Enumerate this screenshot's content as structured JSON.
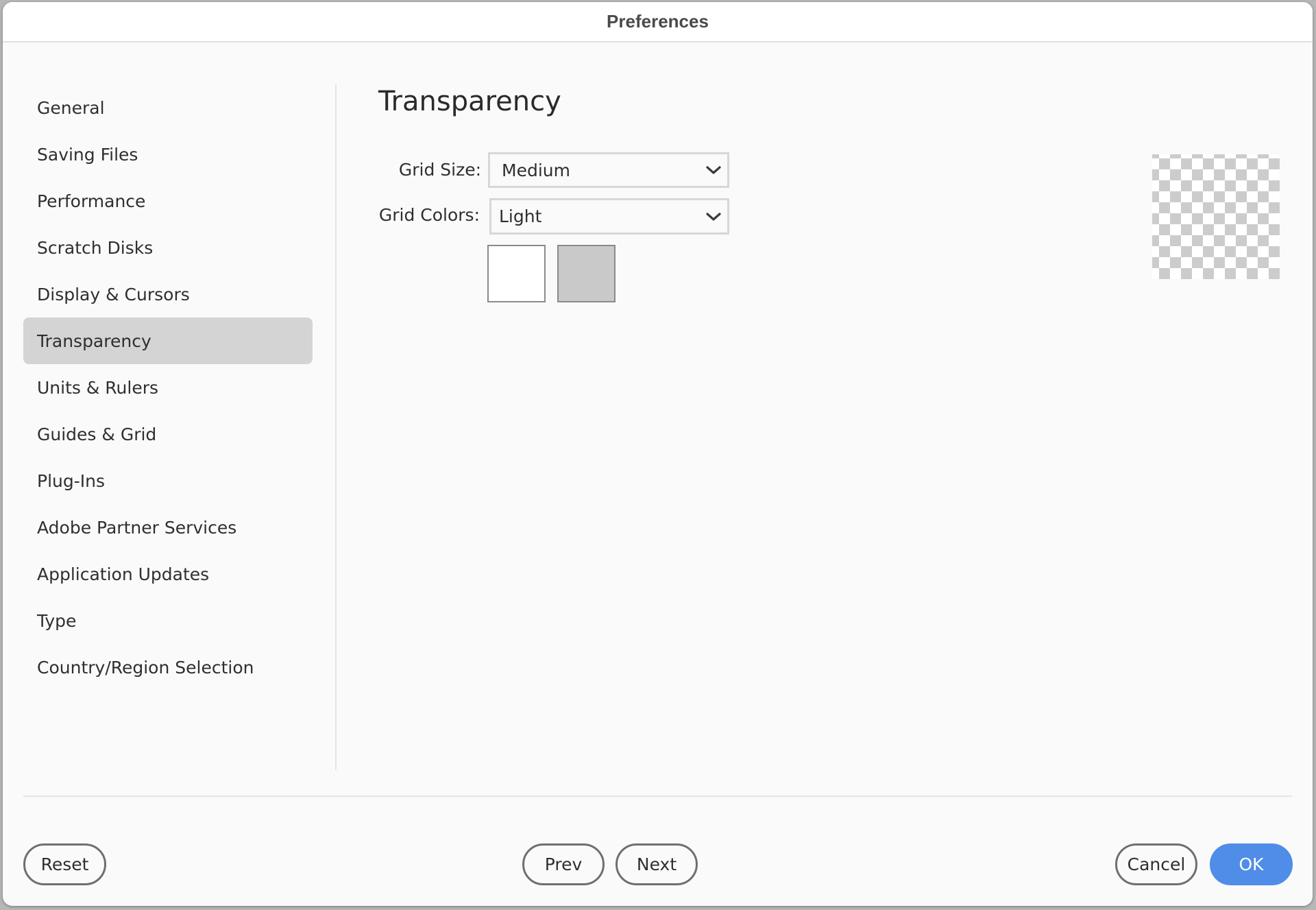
{
  "window": {
    "title": "Preferences"
  },
  "sidebar": {
    "items": [
      {
        "label": "General",
        "selected": false
      },
      {
        "label": "Saving Files",
        "selected": false
      },
      {
        "label": "Performance",
        "selected": false
      },
      {
        "label": "Scratch Disks",
        "selected": false
      },
      {
        "label": "Display & Cursors",
        "selected": false
      },
      {
        "label": "Transparency",
        "selected": true
      },
      {
        "label": "Units & Rulers",
        "selected": false
      },
      {
        "label": "Guides & Grid",
        "selected": false
      },
      {
        "label": "Plug-Ins",
        "selected": false
      },
      {
        "label": "Adobe Partner Services",
        "selected": false
      },
      {
        "label": "Application Updates",
        "selected": false
      },
      {
        "label": "Type",
        "selected": false
      },
      {
        "label": "Country/Region Selection",
        "selected": false
      }
    ]
  },
  "main": {
    "title": "Transparency",
    "grid_size": {
      "label": "Grid Size:",
      "value": "Medium"
    },
    "grid_colors": {
      "label": "Grid Colors:",
      "value": "Light",
      "swatch_1_color": "#ffffff",
      "swatch_2_color": "#c9c9c9"
    },
    "preview": {
      "icon": "transparency-checkerboard-preview",
      "color_light": "#ffffff",
      "color_dark": "#cccccc"
    }
  },
  "footer": {
    "reset_label": "Reset",
    "prev_label": "Prev",
    "next_label": "Next",
    "cancel_label": "Cancel",
    "ok_label": "OK",
    "accent_color": "#4f8de8"
  }
}
